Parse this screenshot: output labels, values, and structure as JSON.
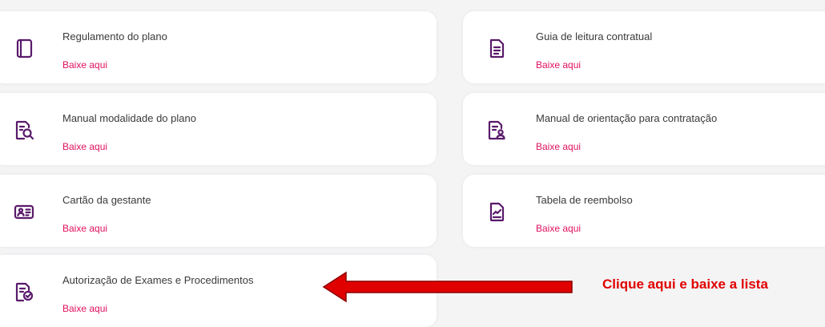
{
  "cards": [
    {
      "title": "Regulamento do plano",
      "link": "Baixe aqui",
      "icon": "notebook-icon"
    },
    {
      "title": "Guia de leitura contratual",
      "link": "Baixe aqui",
      "icon": "document-icon"
    },
    {
      "title": "Manual modalidade do plano",
      "link": "Baixe aqui",
      "icon": "document-search-icon"
    },
    {
      "title": "Manual de orientação para contratação",
      "link": "Baixe aqui",
      "icon": "document-user-icon"
    },
    {
      "title": "Cartão da gestante",
      "link": "Baixe aqui",
      "icon": "id-card-icon"
    },
    {
      "title": "Tabela de reembolso",
      "link": "Baixe aqui",
      "icon": "document-chart-icon"
    },
    {
      "title": "Autorização de Exames e Procedimentos",
      "link": "Baixe aqui",
      "icon": "document-check-icon"
    }
  ],
  "annotation": {
    "callout": "Clique aqui e baixe a lista",
    "arrow_color": "#e10000"
  },
  "colors": {
    "icon": "#5a1a6b",
    "link": "#e0115f",
    "title": "#3a3a3a",
    "background": "#f4f4f5"
  }
}
